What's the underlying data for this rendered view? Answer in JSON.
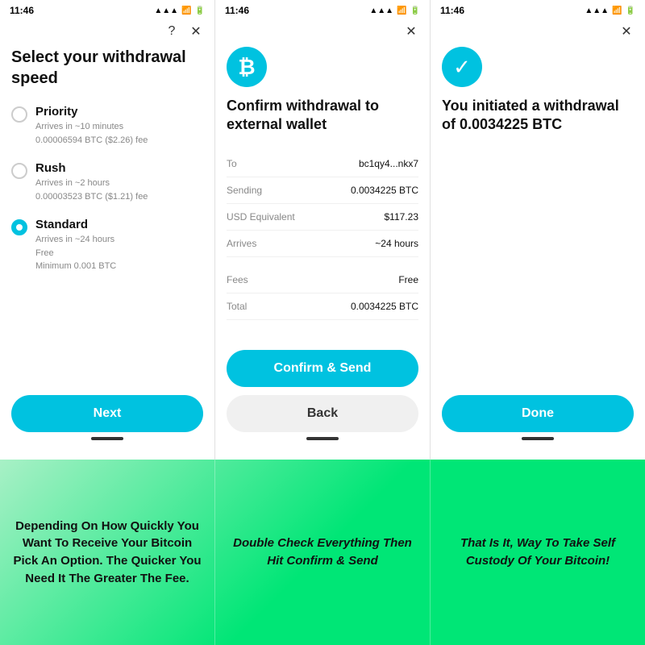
{
  "screens": [
    {
      "time": "11:46",
      "title": "Select your withdrawal speed",
      "options": [
        {
          "id": "priority",
          "label": "Priority",
          "desc": "Arrives in ~10 minutes\n0.00006594 BTC ($2.26) fee",
          "selected": false
        },
        {
          "id": "rush",
          "label": "Rush",
          "desc": "Arrives in ~2 hours\n0.00003523 BTC ($1.21) fee",
          "selected": false
        },
        {
          "id": "standard",
          "label": "Standard",
          "desc": "Arrives in ~24 hours\nFree\nMinimum 0.001 BTC",
          "selected": true
        }
      ],
      "button_label": "Next",
      "has_question": true,
      "has_close": true
    },
    {
      "time": "11:46",
      "title": "Confirm withdrawal to external wallet",
      "details": [
        {
          "label": "To",
          "value": "bc1qy4...nkx7"
        },
        {
          "label": "Sending",
          "value": "0.0034225 BTC"
        },
        {
          "label": "USD Equivalent",
          "value": "$117.23"
        },
        {
          "label": "Arrives",
          "value": "~24 hours"
        }
      ],
      "details2": [
        {
          "label": "Fees",
          "value": "Free"
        },
        {
          "label": "Total",
          "value": "0.0034225 BTC"
        }
      ],
      "primary_button": "Confirm & Send",
      "secondary_button": "Back",
      "has_close": true
    },
    {
      "time": "11:46",
      "title": "You initiated a withdrawal of 0.0034225 BTC",
      "button_label": "Done",
      "has_close": true
    }
  ],
  "captions": [
    "Depending On How Quickly You Want To Receive Your Bitcoin Pick An Option. The Quicker You Need It The Greater The Fee.",
    "Double Check Everything Then Hit Confirm & Send",
    "That Is It, Way To Take Self Custody Of Your Bitcoin!"
  ]
}
